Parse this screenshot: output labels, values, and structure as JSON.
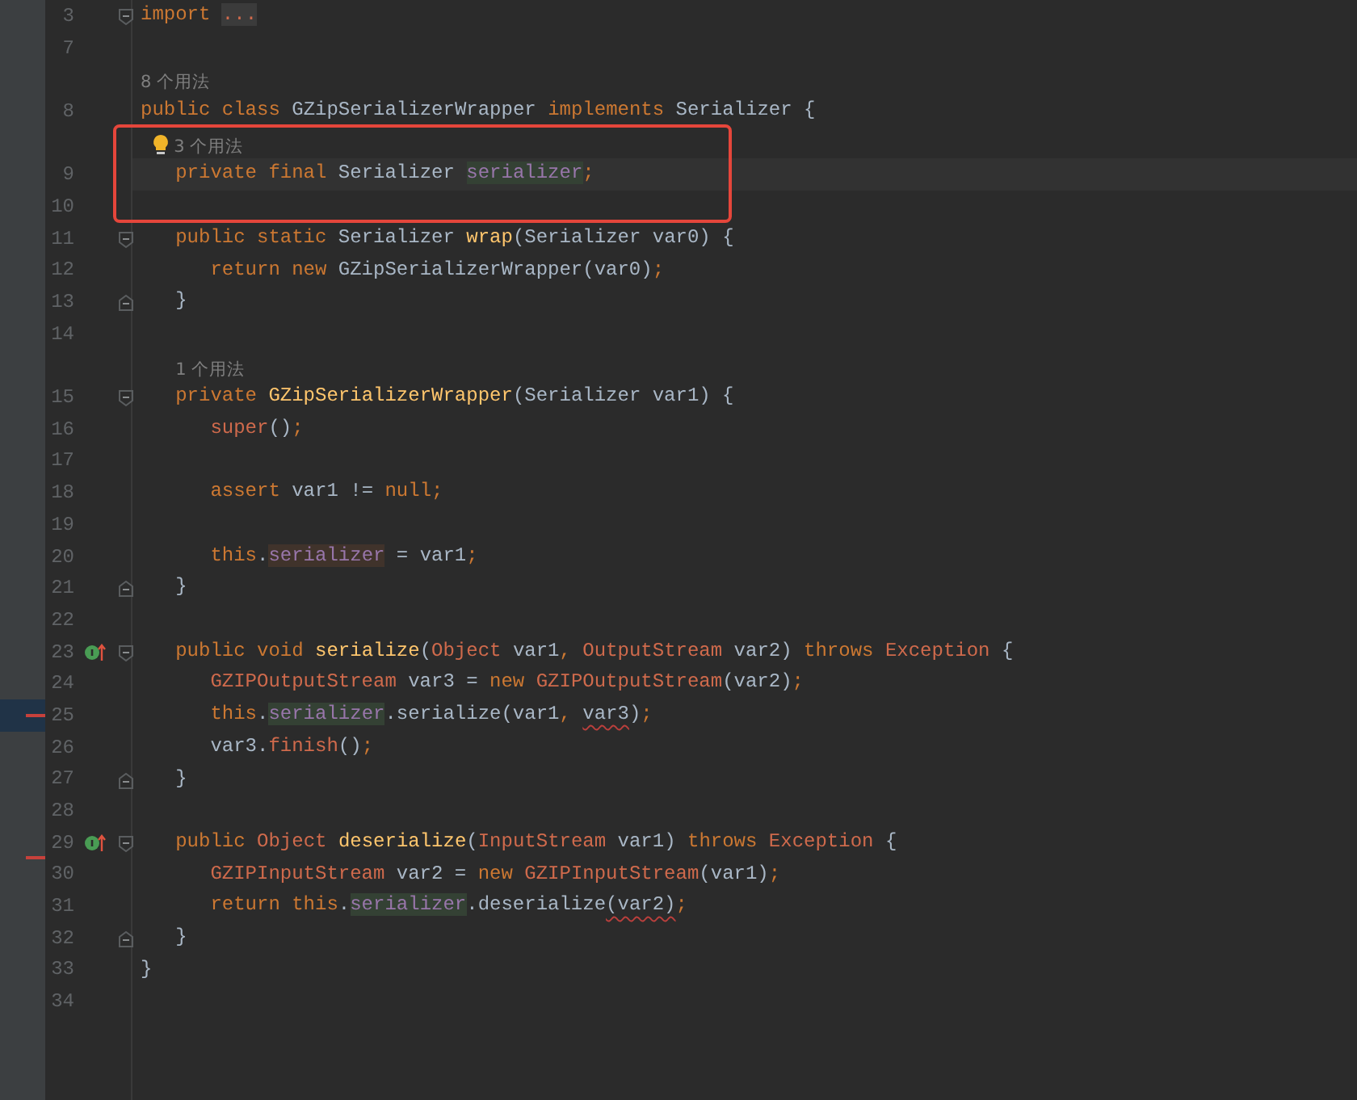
{
  "editor": {
    "lines": [
      {
        "number": "3",
        "fold_start": true,
        "tokens": [
          {
            "text": "import ",
            "kind": "kw"
          },
          {
            "text": "...",
            "kind": "folded"
          }
        ]
      },
      {
        "number": "7"
      },
      {
        "number": "8",
        "hint": "8 个用法",
        "tokens": [
          {
            "text": "public class ",
            "kind": "kw"
          },
          {
            "text": "GZipSerializerWrapper ",
            "kind": "plain"
          },
          {
            "text": "implements ",
            "kind": "kw"
          },
          {
            "text": "Serializer {",
            "kind": "plain"
          }
        ],
        "children": [
          {
            "number": "9",
            "hint": "3 个用法",
            "hint_bulb": true,
            "current": true,
            "boxed": true,
            "tokens": [
              {
                "text": "private final ",
                "kind": "kw"
              },
              {
                "text": "Serializer ",
                "kind": "plain"
              },
              {
                "text": "serializer",
                "kind": "field_read"
              },
              {
                "text": ";",
                "kind": "punct"
              }
            ]
          },
          {
            "number": "10",
            "boxed": true
          },
          {
            "number": "11",
            "fold_start": true,
            "tokens": [
              {
                "text": "public static ",
                "kind": "kw"
              },
              {
                "text": "Serializer ",
                "kind": "plain"
              },
              {
                "text": "wrap",
                "kind": "decl"
              },
              {
                "text": "(Serializer var0) {",
                "kind": "plain"
              }
            ],
            "children": [
              {
                "number": "12",
                "tokens": [
                  {
                    "text": "return new ",
                    "kind": "kw"
                  },
                  {
                    "text": "GZipSerializerWrapper(var0)",
                    "kind": "plain"
                  },
                  {
                    "text": ";",
                    "kind": "punct"
                  }
                ]
              }
            ]
          },
          {
            "number": "13",
            "fold_end": true,
            "tokens": [
              {
                "text": "}",
                "kind": "plain"
              }
            ]
          },
          {
            "number": "14"
          },
          {
            "number": "15",
            "hint": "1 个用法",
            "fold_start": true,
            "tokens": [
              {
                "text": "private ",
                "kind": "kw"
              },
              {
                "text": "GZipSerializerWrapper",
                "kind": "decl"
              },
              {
                "text": "(Serializer var1) {",
                "kind": "plain"
              }
            ],
            "children": [
              {
                "number": "16",
                "tokens": [
                  {
                    "text": "super",
                    "kind": "cls"
                  },
                  {
                    "text": "()",
                    "kind": "plain"
                  },
                  {
                    "text": ";",
                    "kind": "punct"
                  }
                ]
              },
              {
                "number": "17"
              },
              {
                "number": "18",
                "tokens": [
                  {
                    "text": "assert ",
                    "kind": "kw"
                  },
                  {
                    "text": "var1 != ",
                    "kind": "plain"
                  },
                  {
                    "text": "null",
                    "kind": "kw"
                  },
                  {
                    "text": ";",
                    "kind": "punct"
                  }
                ]
              },
              {
                "number": "19"
              },
              {
                "number": "20",
                "tokens": [
                  {
                    "text": "this",
                    "kind": "kw"
                  },
                  {
                    "text": ".",
                    "kind": "plain"
                  },
                  {
                    "text": "serializer",
                    "kind": "field_write"
                  },
                  {
                    "text": " = var1",
                    "kind": "plain"
                  },
                  {
                    "text": ";",
                    "kind": "punct"
                  }
                ]
              }
            ]
          },
          {
            "number": "21",
            "fold_end": true,
            "tokens": [
              {
                "text": "}",
                "kind": "plain"
              }
            ]
          },
          {
            "number": "22"
          },
          {
            "number": "23",
            "fold_start": true,
            "implements": true,
            "tokens": [
              {
                "text": "public void ",
                "kind": "kw"
              },
              {
                "text": "serialize",
                "kind": "decl"
              },
              {
                "text": "(",
                "kind": "plain"
              },
              {
                "text": "Object ",
                "kind": "cls"
              },
              {
                "text": "var1",
                "kind": "plain"
              },
              {
                "text": ", ",
                "kind": "punct"
              },
              {
                "text": "OutputStream ",
                "kind": "cls"
              },
              {
                "text": "var2) ",
                "kind": "plain"
              },
              {
                "text": "throws ",
                "kind": "kw"
              },
              {
                "text": "Exception ",
                "kind": "cls"
              },
              {
                "text": "{",
                "kind": "plain"
              }
            ],
            "children": [
              {
                "number": "24",
                "tokens": [
                  {
                    "text": "GZIPOutputStream ",
                    "kind": "cls"
                  },
                  {
                    "text": "var3 = ",
                    "kind": "plain"
                  },
                  {
                    "text": "new ",
                    "kind": "kw"
                  },
                  {
                    "text": "GZIPOutputStream",
                    "kind": "cls"
                  },
                  {
                    "text": "(var2)",
                    "kind": "plain"
                  },
                  {
                    "text": ";",
                    "kind": "punct"
                  }
                ]
              },
              {
                "number": "25",
                "change_marker": true,
                "tokens": [
                  {
                    "text": "this",
                    "kind": "kw"
                  },
                  {
                    "text": ".",
                    "kind": "plain"
                  },
                  {
                    "text": "serializer",
                    "kind": "field_read"
                  },
                  {
                    "text": ".serialize(var1",
                    "kind": "plain"
                  },
                  {
                    "text": ", ",
                    "kind": "punct"
                  },
                  {
                    "text": "var3",
                    "kind": "err"
                  },
                  {
                    "text": ")",
                    "kind": "plain"
                  },
                  {
                    "text": ";",
                    "kind": "punct"
                  }
                ]
              },
              {
                "number": "26",
                "tokens": [
                  {
                    "text": "var3.",
                    "kind": "plain"
                  },
                  {
                    "text": "finish",
                    "kind": "cls"
                  },
                  {
                    "text": "()",
                    "kind": "plain"
                  },
                  {
                    "text": ";",
                    "kind": "punct"
                  }
                ]
              }
            ]
          },
          {
            "number": "27",
            "fold_end": true,
            "tokens": [
              {
                "text": "}",
                "kind": "plain"
              }
            ]
          },
          {
            "number": "28"
          },
          {
            "number": "29",
            "fold_start": true,
            "implements": true,
            "tokens": [
              {
                "text": "public ",
                "kind": "kw"
              },
              {
                "text": "Object ",
                "kind": "cls"
              },
              {
                "text": "deserialize",
                "kind": "decl"
              },
              {
                "text": "(",
                "kind": "plain"
              },
              {
                "text": "InputStream ",
                "kind": "cls"
              },
              {
                "text": "var1) ",
                "kind": "plain"
              },
              {
                "text": "throws ",
                "kind": "kw"
              },
              {
                "text": "Exception ",
                "kind": "cls"
              },
              {
                "text": "{",
                "kind": "plain"
              }
            ],
            "children": [
              {
                "number": "30",
                "error_marker": true,
                "tokens": [
                  {
                    "text": "GZIPInputStream ",
                    "kind": "cls"
                  },
                  {
                    "text": "var2 = ",
                    "kind": "plain"
                  },
                  {
                    "text": "new ",
                    "kind": "kw"
                  },
                  {
                    "text": "GZIPInputStream",
                    "kind": "cls"
                  },
                  {
                    "text": "(var1)",
                    "kind": "plain"
                  },
                  {
                    "text": ";",
                    "kind": "punct"
                  }
                ]
              },
              {
                "number": "31",
                "tokens": [
                  {
                    "text": "return this",
                    "kind": "kw"
                  },
                  {
                    "text": ".",
                    "kind": "plain"
                  },
                  {
                    "text": "serializer",
                    "kind": "field_read"
                  },
                  {
                    "text": ".deserialize",
                    "kind": "plain"
                  },
                  {
                    "text": "(var2)",
                    "kind": "err"
                  },
                  {
                    "text": ";",
                    "kind": "punct"
                  }
                ]
              }
            ]
          },
          {
            "number": "32",
            "fold_end": true,
            "tokens": [
              {
                "text": "}",
                "kind": "plain"
              }
            ]
          }
        ]
      },
      {
        "number": "33",
        "tokens": [
          {
            "text": "}",
            "kind": "plain"
          }
        ]
      },
      {
        "number": "34"
      }
    ]
  }
}
